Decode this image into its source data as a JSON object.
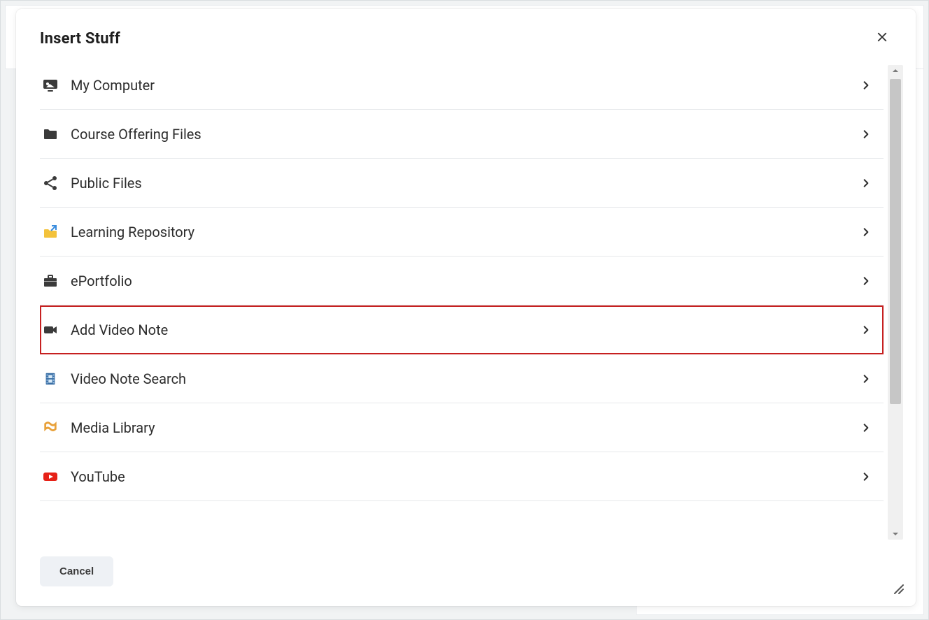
{
  "dialog": {
    "title": "Insert Stuff",
    "items": [
      {
        "label": "My Computer",
        "icon": "computer-icon"
      },
      {
        "label": "Course Offering Files",
        "icon": "folder-icon"
      },
      {
        "label": "Public Files",
        "icon": "share-icon"
      },
      {
        "label": "Learning Repository",
        "icon": "repository-icon"
      },
      {
        "label": "ePortfolio",
        "icon": "briefcase-icon"
      },
      {
        "label": "Add Video Note",
        "icon": "video-camera-icon",
        "highlighted": true
      },
      {
        "label": "Video Note Search",
        "icon": "film-strip-icon"
      },
      {
        "label": "Media Library",
        "icon": "media-icon"
      },
      {
        "label": "YouTube",
        "icon": "youtube-icon"
      }
    ],
    "cancel_label": "Cancel"
  }
}
